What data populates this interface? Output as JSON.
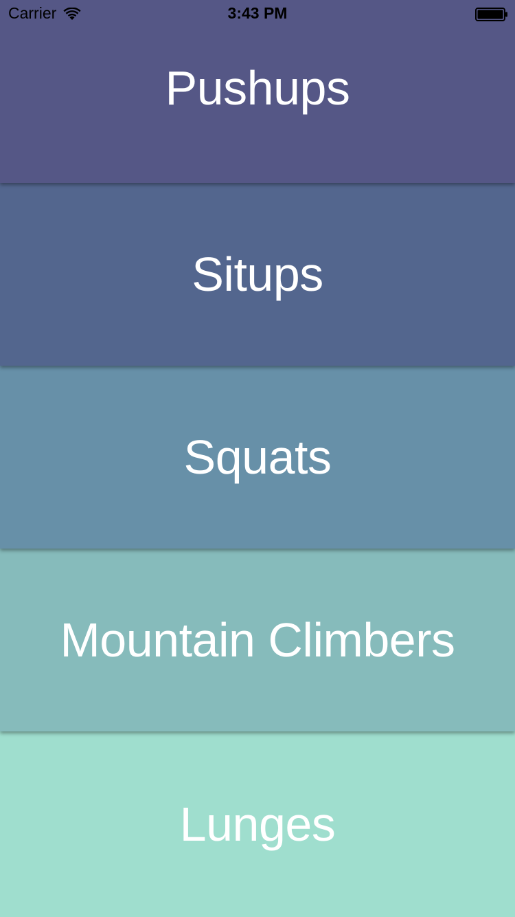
{
  "status_bar": {
    "carrier": "Carrier",
    "time": "3:43 PM"
  },
  "exercises": [
    {
      "label": "Pushups",
      "color": "#555786"
    },
    {
      "label": "Situps",
      "color": "#53668E"
    },
    {
      "label": "Squats",
      "color": "#6790A8"
    },
    {
      "label": "Mountain Climbers",
      "color": "#86BBBB"
    },
    {
      "label": "Lunges",
      "color": "#9FDECE"
    }
  ]
}
